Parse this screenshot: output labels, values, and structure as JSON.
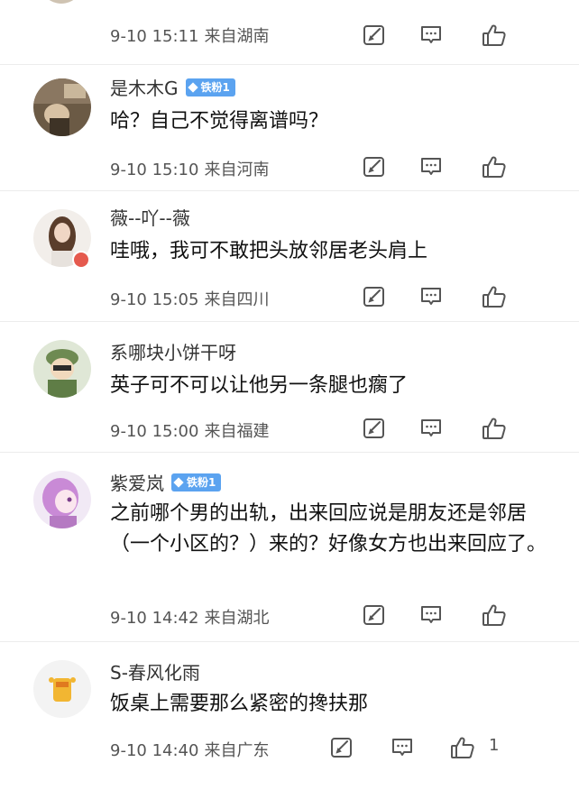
{
  "comments": [
    {
      "time": "9-10 15:11",
      "location": "来自湖南"
    },
    {
      "username": "是木木G",
      "badge": "铁粉1",
      "text": "哈？自己不觉得离谱吗？",
      "time": "9-10 15:10",
      "location": "来自河南"
    },
    {
      "username": "薇--吖--薇",
      "text": "哇哦，我可不敢把头放邻居老头肩上",
      "time": "9-10 15:05",
      "location": "来自四川"
    },
    {
      "username": "系哪块小饼干呀",
      "text": "英子可不可以让他另一条腿也瘸了",
      "time": "9-10 15:00",
      "location": "来自福建"
    },
    {
      "username": "紫爱岚",
      "badge": "铁粉1",
      "text": "之前哪个男的出轨，出来回应说是朋友还是邻居（一个小区的？）来的？好像女方也出来回应了。",
      "time": "9-10 14:42",
      "location": "来自湖北"
    },
    {
      "username": "S-春风化雨",
      "text": "饭桌上需要那么紧密的搀扶那",
      "time": "9-10 14:40",
      "location": "来自广东",
      "likes": "1"
    }
  ],
  "icons": {
    "edit": "edit-icon",
    "reply": "comment-icon",
    "like": "thumbs-up-icon"
  },
  "colors": {
    "badge": "#5ba3f0",
    "meta_text": "#555555",
    "divider": "#ececec"
  }
}
